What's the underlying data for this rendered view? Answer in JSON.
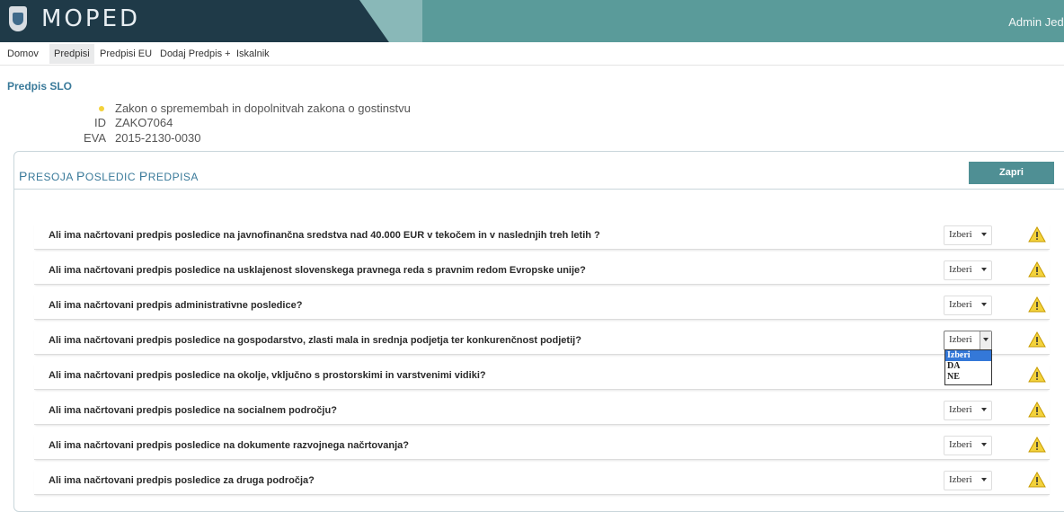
{
  "app": {
    "title": "MOPED",
    "user": "Admin Jedr"
  },
  "nav": [
    {
      "label": "Domov",
      "active": false
    },
    {
      "label": "Predpisi",
      "active": true
    },
    {
      "label": "Predpisi EU",
      "active": false
    },
    {
      "label": "Dodaj Predpis +",
      "active": false
    },
    {
      "label": "Iskalnik",
      "active": false
    }
  ],
  "section": {
    "title": "Predpis SLO"
  },
  "regulation": {
    "name": "Zakon o spremembah in dopolnitvah zakona o gostinstvu",
    "id_label": "ID",
    "id_value": "ZAKO7064",
    "eva_label": "EVA",
    "eva_value": "2015-2130-0030"
  },
  "panel": {
    "title_first": "P",
    "title_rest": "RESOJA ",
    "title_p2_first": "P",
    "title_p2_rest": "OSLEDIC ",
    "title_p3_first": "P",
    "title_p3_rest": "REDPISA",
    "close_label": "Zapri"
  },
  "questions": [
    {
      "text": "Ali ima načrtovani predpis posledice na javnofinančna sredstva nad 40.000 EUR v tekočem in v naslednjih treh letih ?",
      "value": "Izberi"
    },
    {
      "text": "Ali ima načrtovani predpis posledice na usklajenost slovenskega pravnega reda s pravnim redom Evropske unije?",
      "value": "Izberi"
    },
    {
      "text": "Ali ima načrtovani predpis administrativne posledice?",
      "value": "Izberi"
    },
    {
      "text": "Ali ima načrtovani predpis posledice na gospodarstvo, zlasti mala in srednja podjetja ter konkurenčnost podjetij?",
      "value": "Izberi"
    },
    {
      "text": "Ali ima načrtovani predpis posledice na okolje, vključno s prostorskimi in varstvenimi vidiki?",
      "value": ""
    },
    {
      "text": "Ali ima načrtovani predpis posledice na socialnem področju?",
      "value": "Izberi"
    },
    {
      "text": "Ali ima načrtovani predpis posledice na dokumente razvojnega načrtovanja?",
      "value": "Izberi"
    },
    {
      "text": "Ali ima načrtovani predpis posledice za druga področja?",
      "value": "Izberi"
    }
  ],
  "dropdown_options": [
    "Izberi",
    "DA",
    "NE"
  ],
  "colors": {
    "accent": "#3a7a9a",
    "button": "#4f8f94",
    "warning": "#f3d23c"
  }
}
